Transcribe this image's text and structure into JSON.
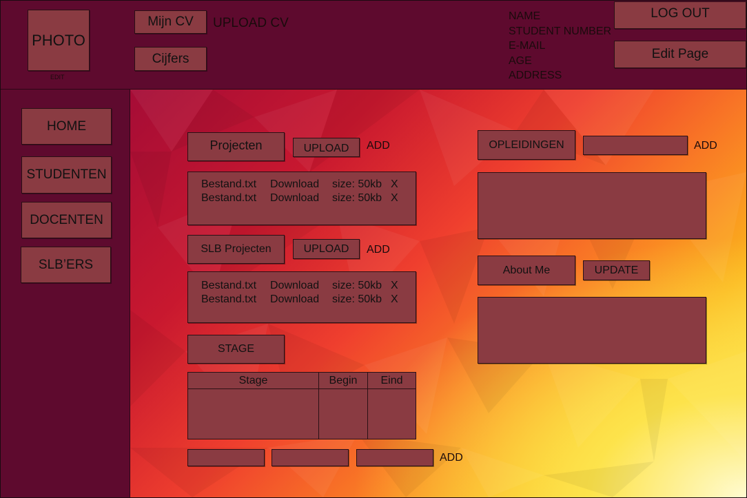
{
  "header": {
    "photo_label": "PHOTO",
    "photo_edit": "EDIT",
    "mijn_cv": "Mijn CV",
    "upload_cv": "UPLOAD CV",
    "cijfers": "Cijfers",
    "info": {
      "name": "NAME",
      "student_number": "STUDENT NUMBER",
      "email": "E-MAIL",
      "age": "AGE",
      "address": "ADDRESS"
    },
    "logout": "LOG OUT",
    "edit_page": "Edit Page"
  },
  "sidebar": {
    "items": [
      {
        "label": "HOME"
      },
      {
        "label": "STUDENTEN"
      },
      {
        "label": "DOCENTEN"
      },
      {
        "label": "SLB’ERS"
      }
    ]
  },
  "projecten": {
    "title": "Projecten",
    "upload": "UPLOAD",
    "add": "ADD",
    "files": [
      {
        "name": "Bestand.txt",
        "download": "Download",
        "size": "size: 50kb",
        "remove": "X"
      },
      {
        "name": "Bestand.txt",
        "download": "Download",
        "size": "size: 50kb",
        "remove": "X"
      }
    ]
  },
  "slb_projecten": {
    "title": "SLB Projecten",
    "upload": "UPLOAD",
    "add": "ADD",
    "files": [
      {
        "name": "Bestand.txt",
        "download": "Download",
        "size": "size: 50kb",
        "remove": "X"
      },
      {
        "name": "Bestand.txt",
        "download": "Download",
        "size": "size: 50kb",
        "remove": "X"
      }
    ]
  },
  "stage": {
    "title": "STAGE",
    "columns": [
      "Stage",
      "Begin",
      "Eind"
    ],
    "add": "ADD"
  },
  "opleidingen": {
    "title": "OPLEIDINGEN",
    "input_value": "",
    "add": "ADD"
  },
  "about": {
    "title": "About Me",
    "update": "UPDATE"
  },
  "colors": {
    "primary_dark": "#5e0a2e",
    "box": "#8a3b42",
    "gradient_start": "#a50c36",
    "gradient_end": "#fde14a"
  }
}
